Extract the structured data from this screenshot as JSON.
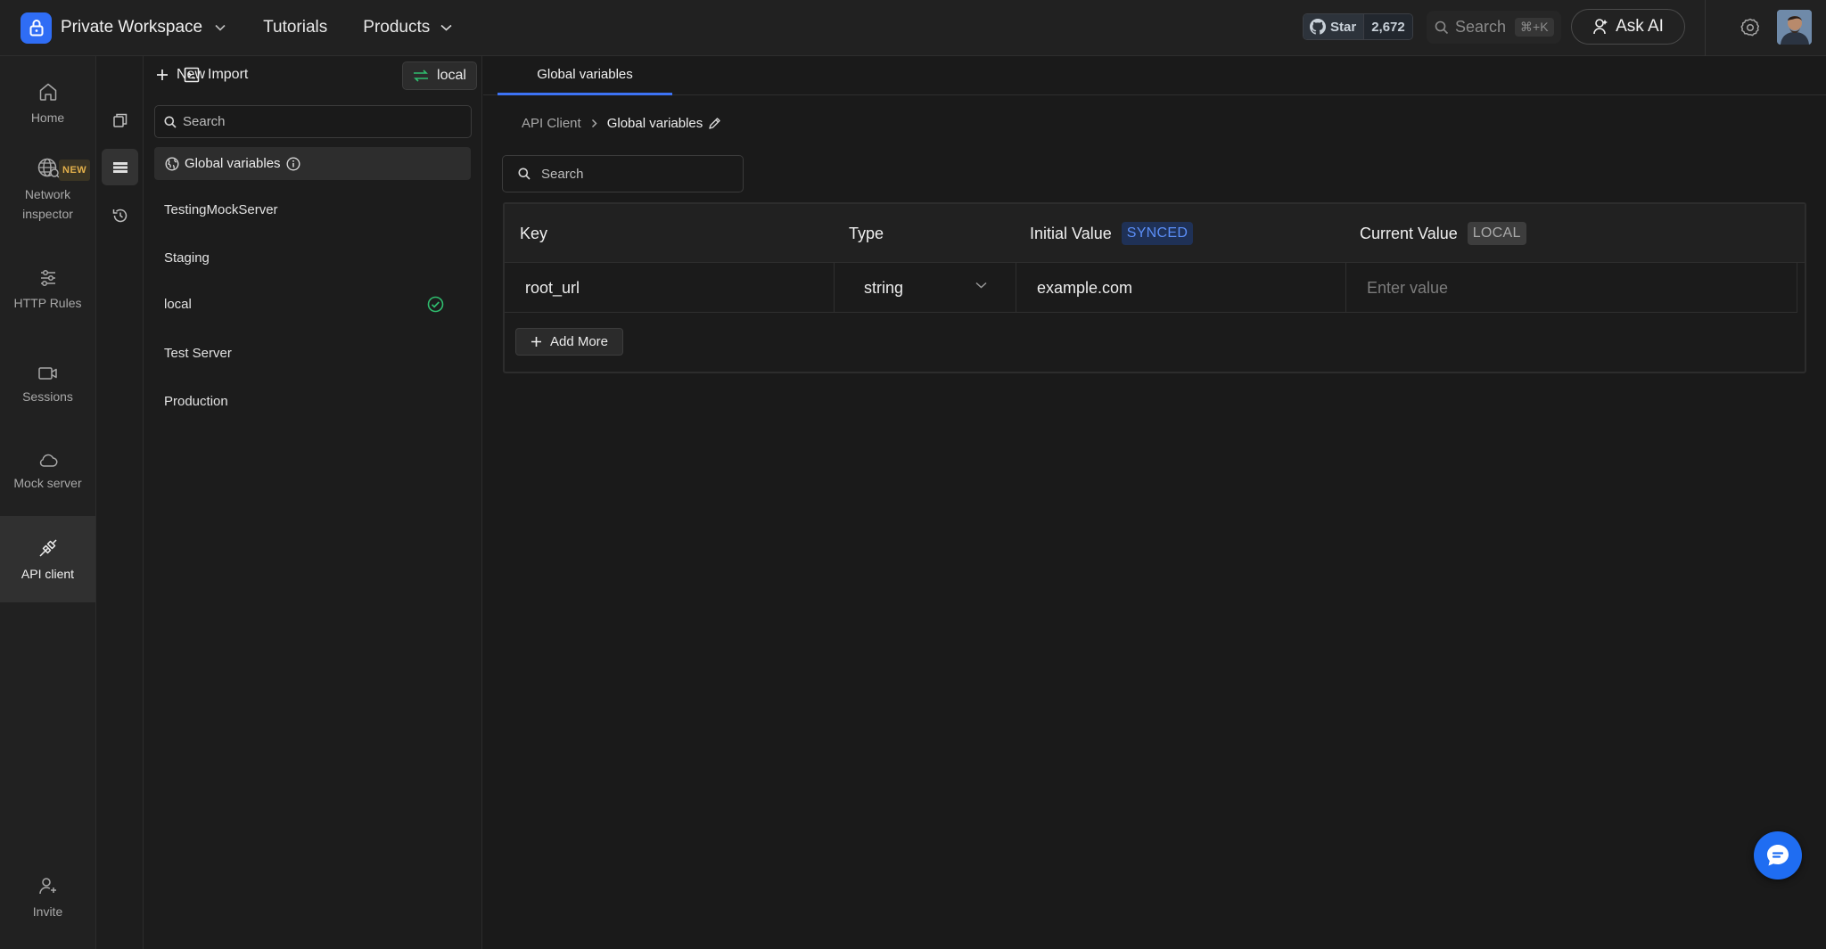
{
  "topbar": {
    "workspace": "Private Workspace",
    "tutorials": "Tutorials",
    "products": "Products",
    "github_star": "Star",
    "github_count": "2,672",
    "search_label": "Search",
    "search_shortcut": "⌘+K",
    "ask_ai": "Ask AI"
  },
  "rail": {
    "home": "Home",
    "network_badge": "NEW",
    "network_line1": "Network",
    "network_line2": "inspector",
    "http_rules": "HTTP Rules",
    "sessions": "Sessions",
    "mock_server": "Mock server",
    "api_client": "API client",
    "invite": "Invite"
  },
  "panel": {
    "new_label": "New",
    "import_label": "Import",
    "active_env": "local",
    "search_placeholder": "Search",
    "global_variables": "Global variables",
    "environments": [
      "TestingMockServer",
      "Staging",
      "local",
      "Test Server",
      "Production"
    ]
  },
  "main": {
    "tab": "Global variables",
    "breadcrumb_root": "API Client",
    "breadcrumb_current": "Global variables",
    "search_placeholder": "Search",
    "table": {
      "headers": {
        "key": "Key",
        "type": "Type",
        "initial": "Initial Value",
        "initial_tag": "SYNCED",
        "current": "Current Value",
        "current_tag": "LOCAL"
      },
      "rows": [
        {
          "key": "root_url",
          "type": "string",
          "initial": "example.com",
          "current_placeholder": "Enter value"
        }
      ],
      "add_more": "Add More"
    }
  },
  "colors": {
    "accent": "#2f6df5",
    "synced_tag": "#5b8ef7",
    "success": "#2fbd6e",
    "chat_fab": "#1f6df2"
  }
}
